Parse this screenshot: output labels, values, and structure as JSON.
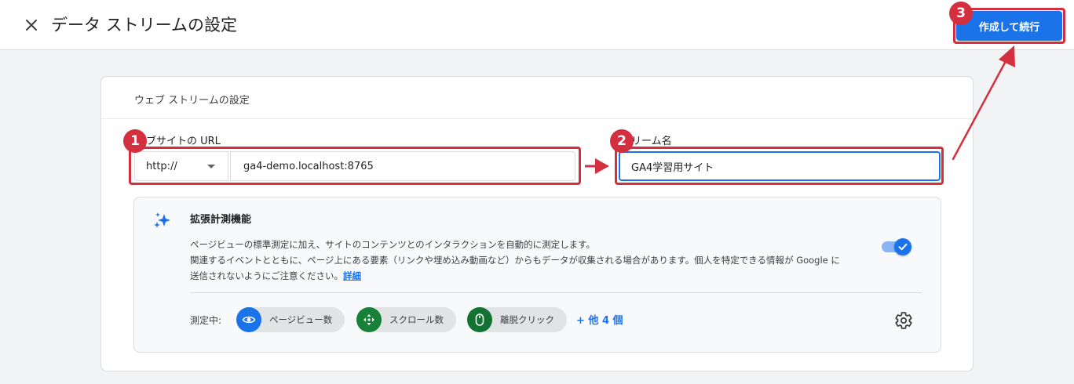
{
  "header": {
    "close_icon": "close-icon",
    "title": "データ ストリームの設定",
    "primary_button": "作成して続行"
  },
  "card": {
    "title": "ウェブ ストリームの設定",
    "url_label": "ェブサイトの URL",
    "protocol_value": "http://",
    "url_value": "ga4-demo.localhost:8765",
    "stream_name_label": "トリーム名",
    "stream_name_value": "GA4学習用サイト"
  },
  "enhanced": {
    "icon": "sparkle-icon",
    "title": "拡張計測機能",
    "desc_line1": "ページビューの標準測定に加え、サイトのコンテンツとのインタラクションを自動的に測定します。",
    "desc_line2": "関連するイベントとともに、ページ上にある要素（リンクや埋め込み動画など）からもデータが収集される場合があります。個人を特定できる情報が Google に",
    "desc_line3": "送信されないようにご注意ください。",
    "details_link": "詳細",
    "toggle_on": true,
    "measuring_label": "測定中:",
    "chips": [
      {
        "label": "ページビュー数",
        "icon": "eye-icon",
        "color": "#1a73e8"
      },
      {
        "label": "スクロール数",
        "icon": "scroll-icon",
        "color": "#188038"
      },
      {
        "label": "離脱クリック",
        "icon": "mouse-icon",
        "color": "#137333"
      }
    ],
    "more_link": "+ 他 4 個",
    "settings_icon": "gear-icon"
  },
  "annotations": {
    "badge_1": "1",
    "badge_2": "2",
    "badge_3": "3",
    "color": "#d32f3f"
  },
  "colors": {
    "accent": "#1a73e8",
    "annotation": "#d32f3f"
  }
}
